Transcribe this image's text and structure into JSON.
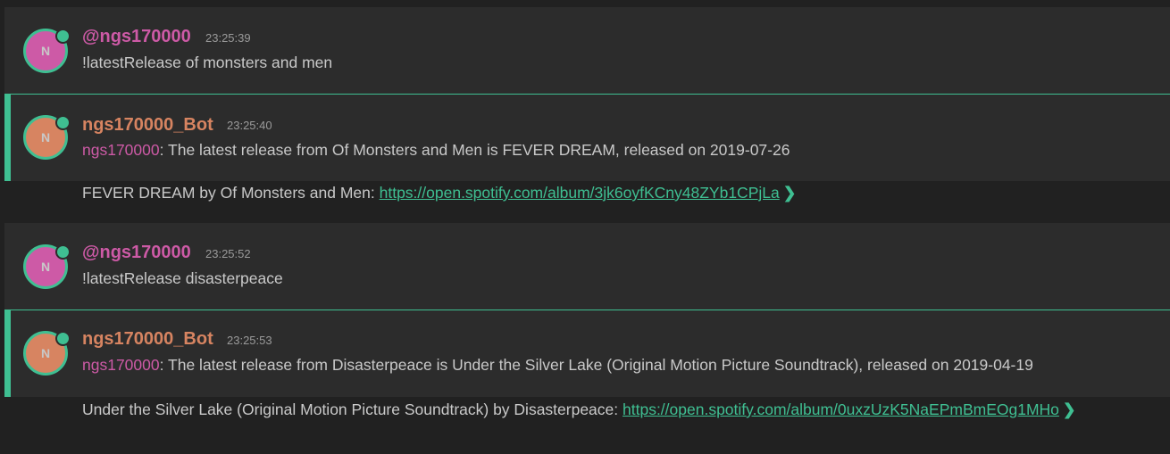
{
  "messages": [
    {
      "author": "@ngs170000",
      "avatar_letter": "N",
      "time": "23:25:39",
      "text": "!latestRelease of monsters and men"
    },
    {
      "author": "ngs170000_Bot",
      "avatar_letter": "N",
      "time": "23:25:40",
      "mention": "ngs170000",
      "text": ": The latest release from Of Monsters and Men is FEVER DREAM, released on 2019-07-26",
      "embed_text": "FEVER DREAM by Of Monsters and Men: ",
      "embed_link": "https://open.spotify.com/album/3jk6oyfKCny48ZYb1CPjLa"
    },
    {
      "author": "@ngs170000",
      "avatar_letter": "N",
      "time": "23:25:52",
      "text": "!latestRelease disasterpeace"
    },
    {
      "author": "ngs170000_Bot",
      "avatar_letter": "N",
      "time": "23:25:53",
      "mention": "ngs170000",
      "text": ": The latest release from Disasterpeace is Under the Silver Lake (Original Motion Picture Soundtrack), released on 2019-04-19",
      "embed_text": "Under the Silver Lake (Original Motion Picture Soundtrack) by Disasterpeace: ",
      "embed_link": "https://open.spotify.com/album/0uxzUzK5NaEPmBmEOg1MHo"
    }
  ],
  "colors": {
    "background": "#212121",
    "message_bg": "#2c2c2c",
    "accent": "#3fbf92",
    "user_color": "#cd5aa6",
    "bot_color": "#d78461"
  },
  "icons": {
    "expand": "chevron-right-icon"
  }
}
